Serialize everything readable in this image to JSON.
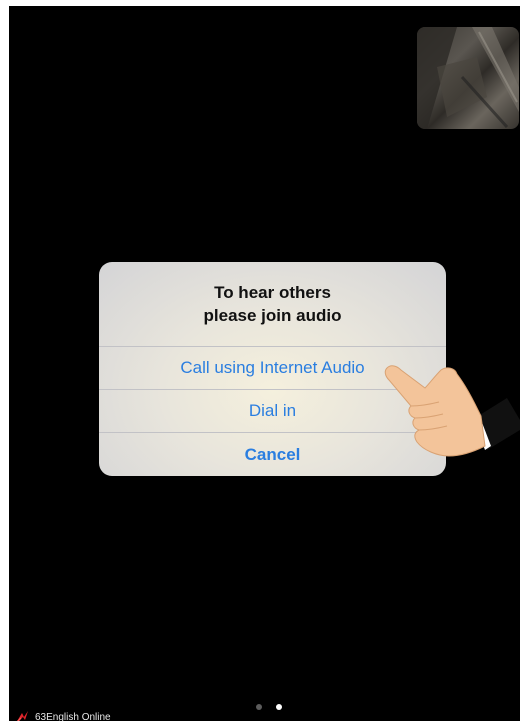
{
  "dialog": {
    "title_line1": "To hear others",
    "title_line2": "please join audio",
    "options": {
      "internet_audio": "Call using Internet Audio",
      "dial_in": "Dial in",
      "cancel": "Cancel"
    }
  },
  "overlay": {
    "pointer": "hand-pointer-icon"
  },
  "video": {
    "self_view": "camera-preview"
  },
  "pagination": {
    "total": 2,
    "active": 2
  },
  "watermark": {
    "text": "63English Online",
    "icon": "logo-icon"
  },
  "colors": {
    "background": "#000000",
    "accent": "#2a7ee0",
    "dialog": "#e8e5dc"
  }
}
